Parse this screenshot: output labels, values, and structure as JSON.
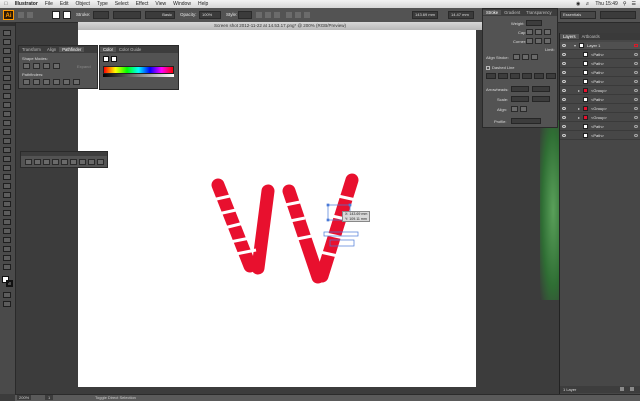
{
  "menubar": {
    "apple": "",
    "items": [
      "Illustrator",
      "File",
      "Edit",
      "Object",
      "Type",
      "Select",
      "Effect",
      "View",
      "Window",
      "Help"
    ],
    "clock": "Thu 15:49"
  },
  "control_bar": {
    "logo": "Ai",
    "stroke_label": "Stroke:",
    "brush_value": "Basic",
    "opacity_label": "Opacity:",
    "opacity_value": "100%",
    "style_label": "Style:",
    "x_value": "143.69 mm",
    "w_value": "14.47 mm",
    "workspace": "Essentials"
  },
  "document": {
    "title": "Screen shot 2012-11-22 at 14.53.17.png* @ 200% (RGB/Preview)"
  },
  "pathfinder_panel": {
    "tabs": [
      "Transform",
      "Align",
      "Pathfinder"
    ],
    "shape_modes_label": "Shape Modes:",
    "expand_label": "Expand",
    "pathfinders_label": "Pathfinders:"
  },
  "color_panel": {
    "tabs": [
      "Color",
      "Color Guide"
    ]
  },
  "stroke_panel": {
    "tabs": [
      "Stroke",
      "Gradient",
      "Transparency"
    ],
    "weight_label": "Weight:",
    "cap_label": "Cap:",
    "corner_label": "Corner:",
    "limit_label": "Limit:",
    "align_stroke_label": "Align Stroke:",
    "dashed_line_label": "Dashed Line",
    "dash_labels": [
      "dash",
      "gap",
      "dash",
      "gap",
      "dash",
      "gap"
    ],
    "arrowheads_label": "Arrowheads:",
    "scale_label": "Scale:",
    "align_label": "Align:",
    "profile_label": "Profile:"
  },
  "layers_panel": {
    "tabs": [
      "Layers",
      "Artboards"
    ],
    "layer_name": "Layer 1",
    "rows": [
      "<Path>",
      "<Path>",
      "<Path>",
      "<Path>",
      "<Group>",
      "<Path>",
      "<Group>",
      "<Group>",
      "<Path>",
      "<Path>"
    ],
    "footer": "1 Layer"
  },
  "selection_tooltip": {
    "line1": "X: 143.69 mm",
    "line2": "Y: 109.11 mm"
  },
  "status": {
    "zoom": "200%",
    "page": "1",
    "tool": "Toggle Direct Selection"
  },
  "colors": {
    "shape_red": "#e8102e",
    "panel_bg": "#535353",
    "artboard": "#ffffff",
    "selection_blue": "#4a7bd8"
  }
}
